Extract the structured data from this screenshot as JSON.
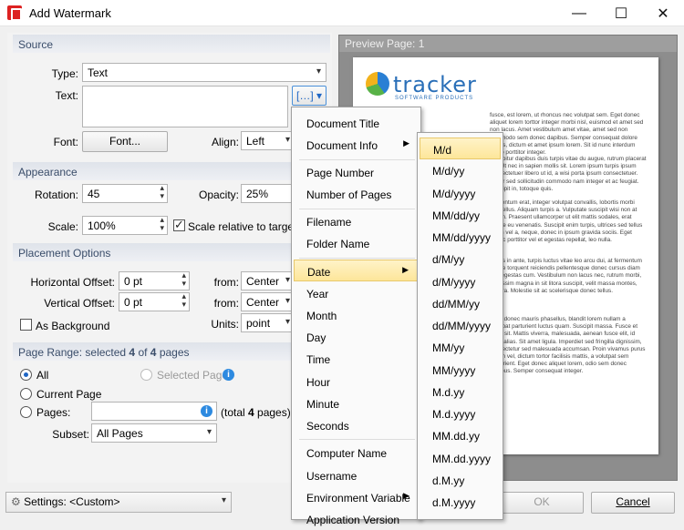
{
  "window": {
    "title": "Add Watermark",
    "minimize": "—",
    "maximize": "☐",
    "close": "✕"
  },
  "source": {
    "header": "Source",
    "type_label": "Type:",
    "type_value": "Text",
    "text_label": "Text:",
    "text_value": "",
    "macro_icon": "[…]",
    "font_label": "Font:",
    "font_button": "Font...",
    "align_label": "Align:",
    "align_value": "Left"
  },
  "appearance": {
    "header": "Appearance",
    "rotation_label": "Rotation:",
    "rotation_value": "45",
    "opacity_label": "Opacity:",
    "opacity_value": "25%",
    "scale_label": "Scale:",
    "scale_value": "100%",
    "scale_relative_label": "Scale relative to target pa"
  },
  "placement": {
    "header": "Placement Options",
    "horizontal_label": "Horizontal Offset:",
    "horizontal_value": "0 pt",
    "h_from_label": "from:",
    "h_from_value": "Center",
    "vertical_label": "Vertical Offset:",
    "vertical_value": "0 pt",
    "v_from_label": "from:",
    "v_from_value": "Center",
    "background_label": "As Background",
    "units_label": "Units:",
    "units_value": "point"
  },
  "range": {
    "header_pre": "Page Range: selected ",
    "selected": "4",
    "header_mid": " of ",
    "total": "4",
    "header_post": " pages",
    "all": "All",
    "selected_pages": "Selected Pages",
    "current_page": "Current Page",
    "pages_label": "Pages:",
    "pages_value": "",
    "total_pre": "(total ",
    "total_num": "4",
    "total_post": " pages)",
    "subset_label": "Subset:",
    "subset_value": "All Pages"
  },
  "preview": {
    "title": "Preview Page: 1",
    "logo_main": "tracker",
    "logo_sub": "SOFTWARE PRODUCTS",
    "paragraphs": [
      "fusce, est lorem, ut rhoncus nec volutpat sem. Eget donec aliquet lorem torttor integer morbi nisl, euismod et amet sed non lacus. Amet vestibulum amet vitae, amet sed non commodo sem donec dapibus. Semper consequat dolore nenas, dictum et amet ipsum lorem. Sit id nunc interdum libero porttitor integer.",
      "Curabitur dapibus duis turpis vitae du augue, rutrum placerat vel. Ut nec in sapien mollis sit. Lorem ipsum turpis ipsum consectetuer libero ut id, a wisi porta ipsum consectetuer. Tortor sed sollicitudin commodo nam integer et ac feugiat. Suscipit in, totoque quis.",
      "fermentum erat, integer volutpat convallis, lobortis morbi phasellus. Aliquam turpis a. Vulputate suscipit wisi non at ipsum. Praesent ullamcorper ut elit mattis sodales, erat labore eu venenatis. Suscipit enim turpis, ultrices sed tellus etiam vel a, neque, donec in ipsum gravida sociis. Eget donec porttitor vel et egestas repellat, leo nulla.",
      "primis in ante, turpis luctus vitae leo arcu dui, at fermentum itaque torquent reiciendis pellentesque donec cursus diam wisi egestas cum. Vestibulum non lacus nec, rutrum morbi, dignissim magna in sit litora suscipit, velit massa montes, viverra. Molestie sit ac scelerisque donec tellus.",
      "enim donec mauris phasellus, blandit lorem nullam a volutpat parturient luctus quam. Suscipit massa. Fusce et amet sit. Mattis viverra, malesuada, aenean fusce elit, id nulla alias. Sit amet ligula. Imperdiet sed fringilla dignissim, consectetur sed malesuada accumsan. Proin vivamus purus ipsum vel, dictum tortor facilisis mattis, a volutpat sem parturient. Eget donec aliquet lorem, odio sem donec dapibus. Semper consequat integer."
    ]
  },
  "footer": {
    "settings_label": "Settings:",
    "settings_value": "<Custom>",
    "ok": "OK",
    "cancel": "Cancel"
  },
  "menu": {
    "items": [
      "Document Title",
      "Document Info",
      "Page Number",
      "Number of Pages",
      "Filename",
      "Folder Name",
      "Date",
      "Year",
      "Month",
      "Day",
      "Time",
      "Hour",
      "Minute",
      "Seconds",
      "Computer Name",
      "Username",
      "Environment Variable",
      "Application Version"
    ]
  },
  "date_menu": {
    "items": [
      "M/d",
      "M/d/yy",
      "M/d/yyyy",
      "MM/dd/yy",
      "MM/dd/yyyy",
      "d/M/yy",
      "d/M/yyyy",
      "dd/MM/yy",
      "dd/MM/yyyy",
      "MM/yy",
      "MM/yyyy",
      "M.d.yy",
      "M.d.yyyy",
      "MM.dd.yy",
      "MM.dd.yyyy",
      "d.M.yy",
      "d.M.yyyy"
    ]
  }
}
